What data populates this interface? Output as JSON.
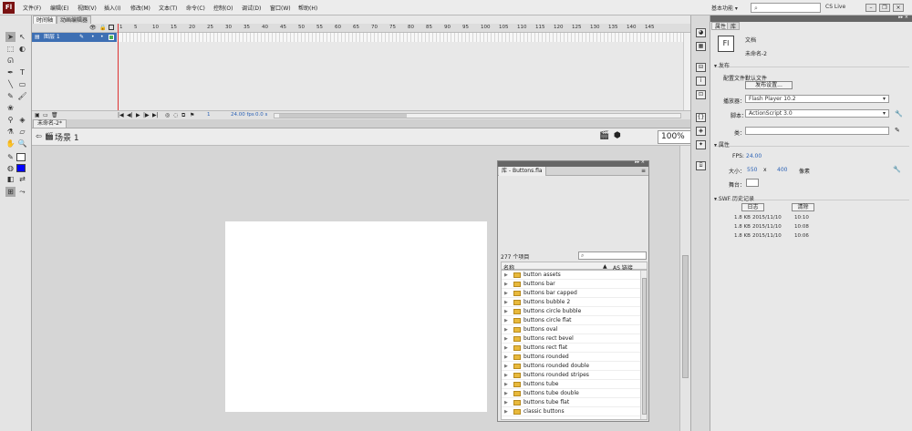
{
  "menubar": {
    "items": [
      "文件(F)",
      "编辑(E)",
      "视图(V)",
      "插入(I)",
      "修改(M)",
      "文本(T)",
      "命令(C)",
      "控制(O)",
      "调试(D)",
      "窗口(W)",
      "帮助(H)"
    ],
    "workspace_label": "基本功能 ▾",
    "cslive_label": "CS Live"
  },
  "timeline": {
    "tabs": [
      "时间轴",
      "动画编辑器"
    ],
    "layer_name": "图层 1",
    "frame_numbers": [
      "1",
      "5",
      "10",
      "15",
      "20",
      "25",
      "30",
      "35",
      "40",
      "45",
      "50",
      "55",
      "60",
      "65",
      "70",
      "75",
      "80",
      "85",
      "90",
      "95",
      "100",
      "105",
      "110",
      "115",
      "120",
      "125",
      "130",
      "135",
      "140",
      "145"
    ],
    "fps": "24.00 fps",
    "time": "0.0 s",
    "current_frame": "1"
  },
  "document": {
    "tab": "未命名-2*",
    "scene": "场景 1",
    "zoom": "100%"
  },
  "library": {
    "tab": "库 - Buttons.fla",
    "count": "277 个项目",
    "col_name": "名称",
    "col_linkage": "AS 链接",
    "items": [
      "button assets",
      "buttons bar",
      "buttons bar capped",
      "buttons bubble 2",
      "buttons circle bubble",
      "buttons circle flat",
      "buttons oval",
      "buttons rect bevel",
      "buttons rect flat",
      "buttons rounded",
      "buttons rounded double",
      "buttons rounded stripes",
      "buttons tube",
      "buttons tube double",
      "buttons tube flat",
      "classic buttons"
    ]
  },
  "properties": {
    "tabs": [
      "属性",
      "库"
    ],
    "doc_type": "文档",
    "doc_name": "未命名-2",
    "publish_section": "发布",
    "profile_label": "配置文件：",
    "profile_value": "默认文件",
    "publish_settings_btn": "发布设置...",
    "player_label": "播放器：",
    "player_value": "Flash Player 10.2",
    "script_label": "脚本：",
    "script_value": "ActionScript 3.0",
    "class_label": "类：",
    "props_section": "属性",
    "fps_label": "FPS:",
    "fps_value": "24.00",
    "size_label": "大小：",
    "width": "550",
    "x_sep": "x",
    "height": "400",
    "unit": "像素",
    "stage_label": "舞台：",
    "swf_section": "SWF 历史记录",
    "log_btn": "日志",
    "clear_btn": "清除",
    "history": [
      {
        "size": "1.8 KB",
        "date": "2015/11/10",
        "time": "10:10"
      },
      {
        "size": "1.8 KB",
        "date": "2015/11/10",
        "time": "10:08"
      },
      {
        "size": "1.8 KB",
        "date": "2015/11/10",
        "time": "10:06"
      }
    ]
  }
}
